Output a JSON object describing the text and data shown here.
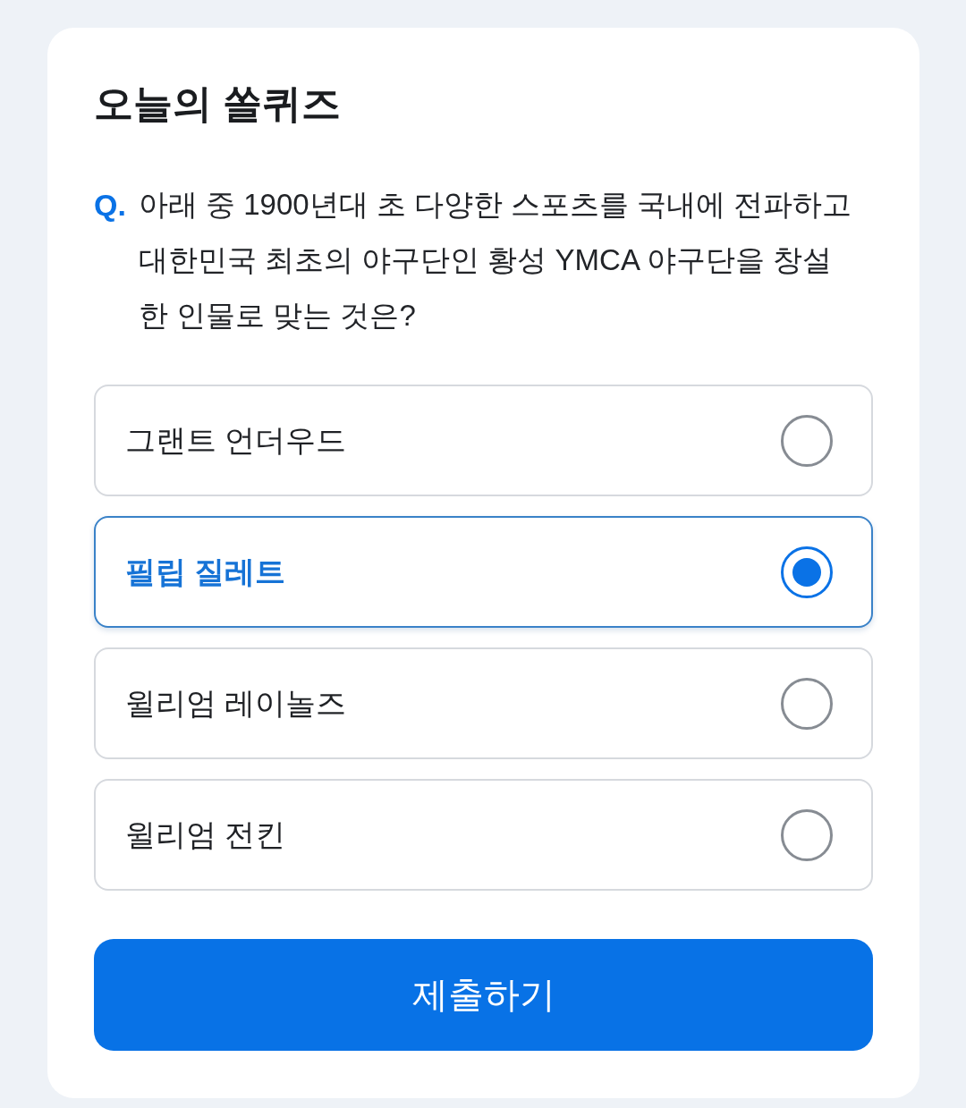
{
  "quiz": {
    "title": "오늘의 쏠퀴즈",
    "question": {
      "marker": "Q.",
      "text": "아래 중 1900년대 초 다양한 스포츠를 국내에 전파하고 대한민국 최초의 야구단인 황성 YMCA 야구단을 창설한 인물로 맞는 것은?"
    },
    "options": [
      {
        "label": "그랜트 언더우드",
        "selected": false
      },
      {
        "label": "필립 질레트",
        "selected": true
      },
      {
        "label": "윌리엄 레이놀즈",
        "selected": false
      },
      {
        "label": "윌리엄 전킨",
        "selected": false
      }
    ],
    "submit_button": "제출하기"
  }
}
